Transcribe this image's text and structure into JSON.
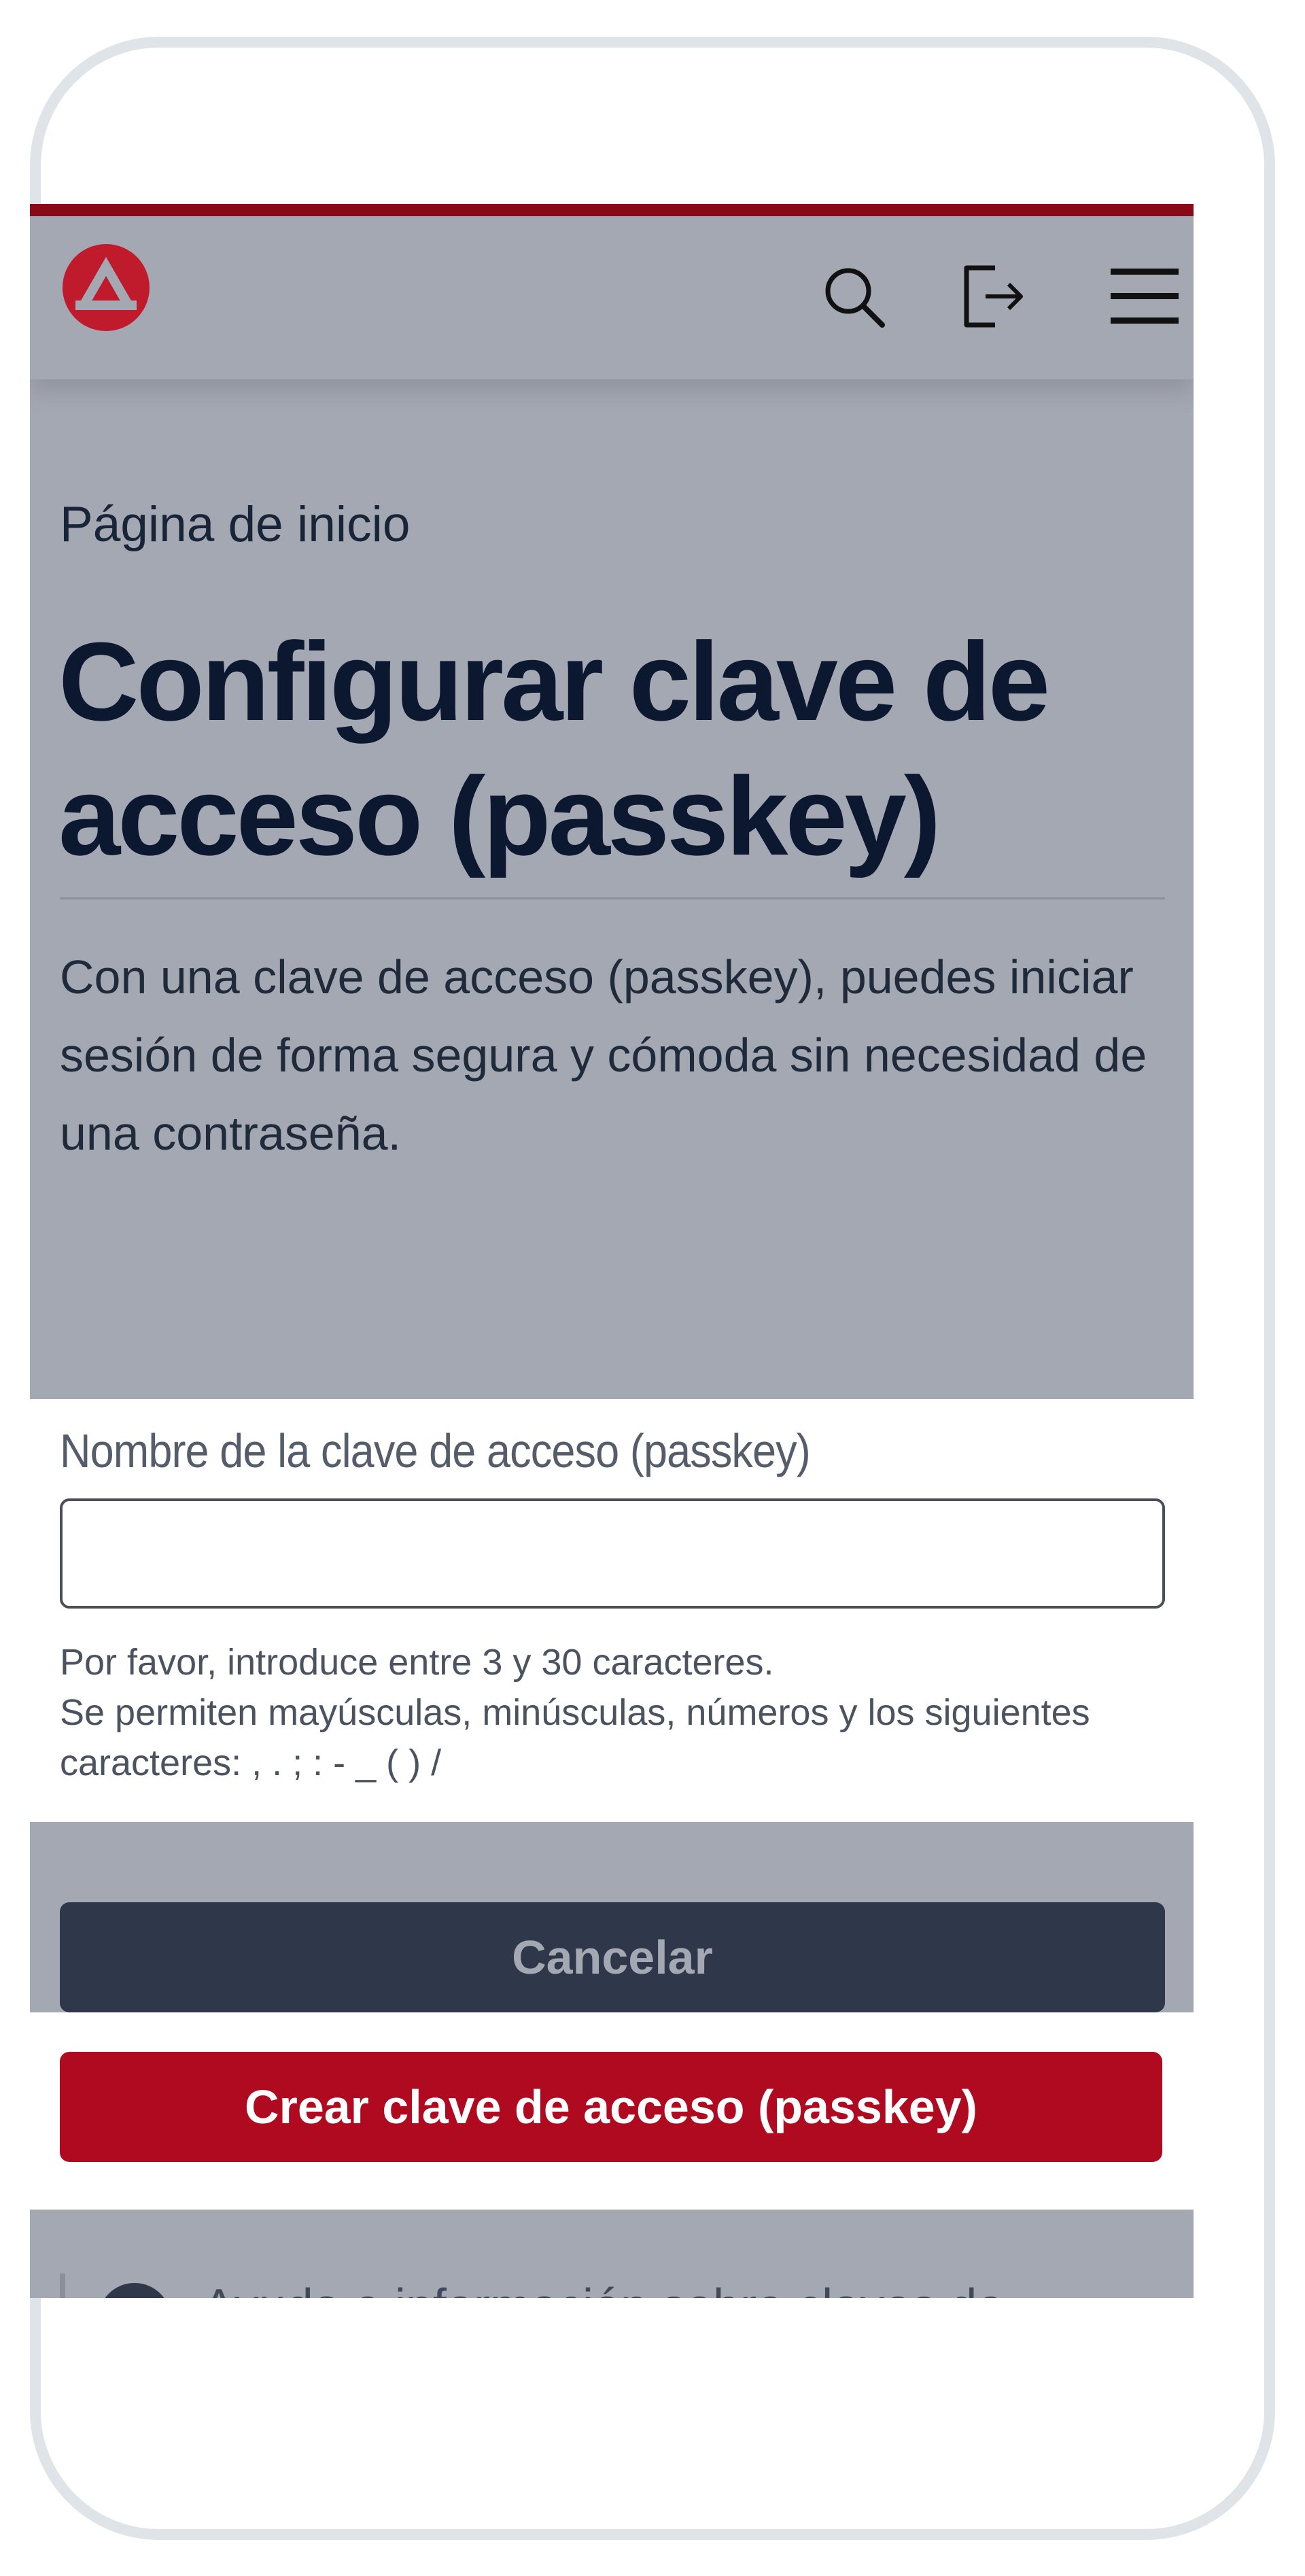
{
  "header": {
    "logo_icon": "agentur-arbeit-logo-icon",
    "search_icon": "search-icon",
    "logout_icon": "logout-icon",
    "menu_icon": "hamburger-menu-icon"
  },
  "breadcrumb": {
    "home": "Página de inicio"
  },
  "page": {
    "title": "Configurar clave de acceso (passkey)",
    "intro": "Con una clave de acceso (passkey), puedes iniciar sesión de forma segura y cómoda sin necesidad de una contraseña."
  },
  "form": {
    "label": "Nombre de la clave de acceso (passkey)",
    "value": "",
    "hint_line1": "Por favor, introduce entre 3 y 30 caracteres.",
    "hint_line2": "Se permiten mayúsculas, minúsculas, números y los siguientes caracteres: , . ; : - _ ( ) /"
  },
  "actions": {
    "cancel_label": "Cancelar",
    "create_label": "Crear clave de acceso (passkey)"
  },
  "help": {
    "icon": "question-icon",
    "label": "Ayuda e información sobre claves de"
  },
  "colors": {
    "accent_red": "#b00a20",
    "top_bar": "#8a0a18",
    "dark_button": "#2f384a",
    "overlay_gray": "#a4a8b3"
  }
}
